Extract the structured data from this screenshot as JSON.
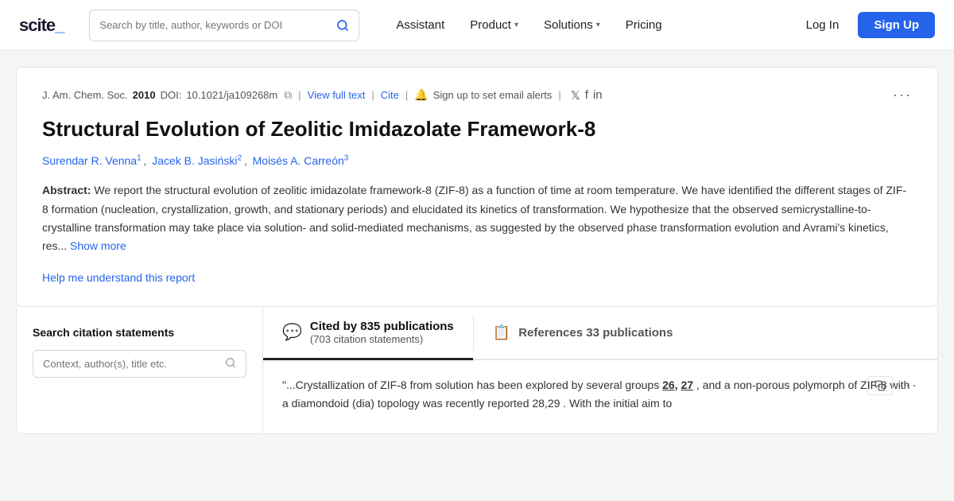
{
  "navbar": {
    "logo": "scite_",
    "search_placeholder": "Search by title, author, keywords or DOI",
    "nav_items": [
      {
        "label": "Assistant",
        "has_dropdown": false
      },
      {
        "label": "Product",
        "has_dropdown": true
      },
      {
        "label": "Solutions",
        "has_dropdown": true
      },
      {
        "label": "Pricing",
        "has_dropdown": false
      }
    ],
    "login_label": "Log In",
    "signup_label": "Sign Up"
  },
  "paper": {
    "journal": "J. Am. Chem. Soc.",
    "year": "2010",
    "doi_label": "DOI:",
    "doi": "10.1021/ja109268m",
    "view_full_text": "View full text",
    "cite": "Cite",
    "email_alerts": "Sign up to set email alerts",
    "title": "Structural Evolution of Zeolitic Imidazolate Framework-8",
    "authors": [
      {
        "name": "Surendar R. Venna",
        "superscript": "1"
      },
      {
        "name": "Jacek B. Jasiński",
        "superscript": "2"
      },
      {
        "name": "Moisés A. Carreón",
        "superscript": "3"
      }
    ],
    "abstract_label": "Abstract:",
    "abstract_text": "We report the structural evolution of zeolitic imidazolate framework-8 (ZIF-8) as a function of time at room temperature. We have identified the different stages of ZIF-8 formation (nucleation, crystallization, growth, and stationary periods) and elucidated its kinetics of transformation. We hypothesize that the observed semicrystalline-to-crystalline transformation may take place via solution- and solid-mediated mechanisms, as suggested by the observed phase transformation evolution and Avrami's kinetics, res...",
    "show_more": "Show more",
    "help_link": "Help me understand this report"
  },
  "sidebar": {
    "title": "Search citation statements",
    "search_placeholder": "Context, author(s), title etc."
  },
  "tabs": [
    {
      "id": "cited-by",
      "active": true,
      "icon": "💬",
      "main_text": "Cited by 835 publications",
      "sub_text": "(703 citation statements)"
    },
    {
      "id": "references",
      "active": false,
      "icon": "📋",
      "main_text": "References 33 publications",
      "sub_text": ""
    }
  ],
  "citation": {
    "quote": "\"...Crystallization of ZIF-8 from solution has been explored by several groups",
    "numbers": "26, 27",
    "continuation": ", and a non-porous polymorph of ZIF-8 with a diamondoid (dia) topology was recently reported 28,29 . With the initial aim to"
  }
}
